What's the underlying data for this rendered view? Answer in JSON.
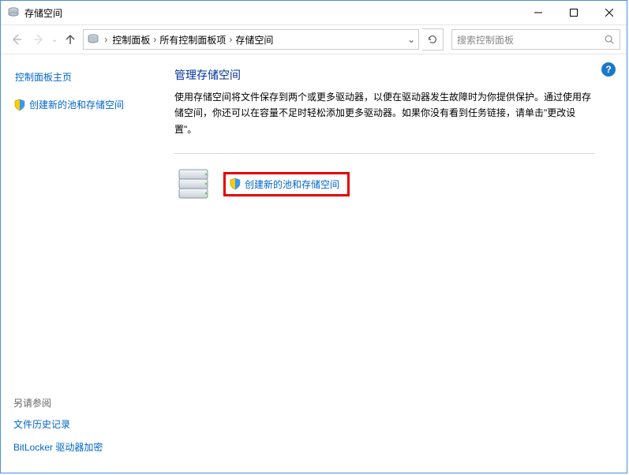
{
  "titlebar": {
    "title": "存储空间"
  },
  "navbar": {
    "breadcrumbs": [
      "控制面板",
      "所有控制面板项",
      "存储空间"
    ],
    "search_placeholder": "搜索控制面板"
  },
  "sidebar": {
    "home_link": "控制面板主页",
    "create_link": "创建新的池和存储空间",
    "see_also_title": "另请参阅",
    "see_also_links": [
      "文件历史记录",
      "BitLocker 驱动器加密"
    ]
  },
  "main": {
    "heading": "管理存储空间",
    "description": "使用存储空间将文件保存到两个或更多驱动器，以便在驱动器发生故障时为你提供保护。通过使用存储空间，你还可以在容量不足时轻松添加更多驱动器。如果你没有看到任务链接，请单击\"更改设置\"。",
    "action_link": "创建新的池和存储空间"
  },
  "help_tooltip": "?"
}
